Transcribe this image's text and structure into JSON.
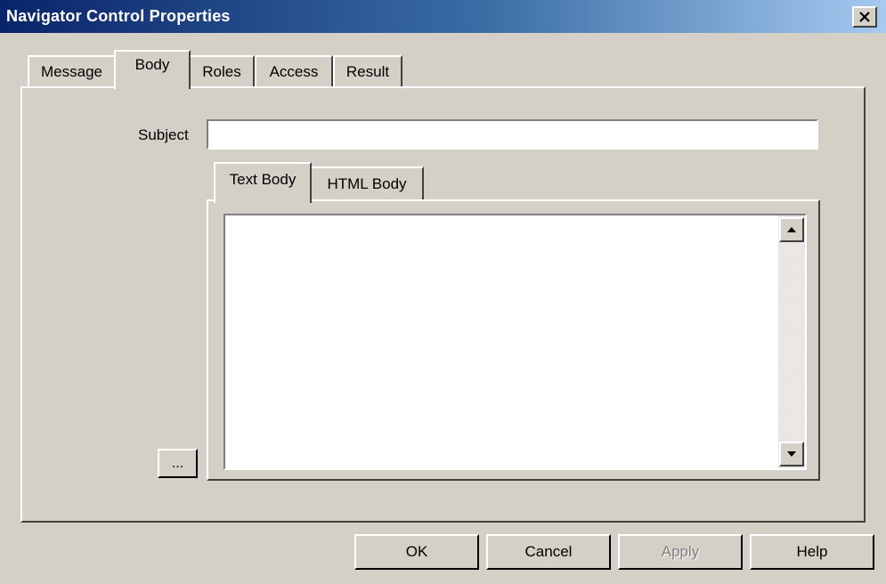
{
  "window": {
    "title": "Navigator Control Properties"
  },
  "tabs": [
    {
      "label": "Message",
      "active": false
    },
    {
      "label": "Body",
      "active": true
    },
    {
      "label": "Roles",
      "active": false
    },
    {
      "label": "Access",
      "active": false
    },
    {
      "label": "Result",
      "active": false
    }
  ],
  "body": {
    "subject_label": "Subject",
    "subject_value": "",
    "ellipsis_label": "...",
    "inner_tabs": [
      {
        "label": "Text Body",
        "active": true
      },
      {
        "label": "HTML Body",
        "active": false
      }
    ],
    "text_body_value": ""
  },
  "buttons": {
    "ok": "OK",
    "cancel": "Cancel",
    "apply": "Apply",
    "help": "Help",
    "apply_disabled": true
  },
  "icons": {
    "close": "close-icon",
    "scroll_up": "scroll-up-arrow-icon",
    "scroll_down": "scroll-down-arrow-icon"
  },
  "colors": {
    "face": "#d4d0c8",
    "title_start": "#0a246a",
    "title_end": "#a6caf0",
    "disabled_text": "#808080"
  }
}
